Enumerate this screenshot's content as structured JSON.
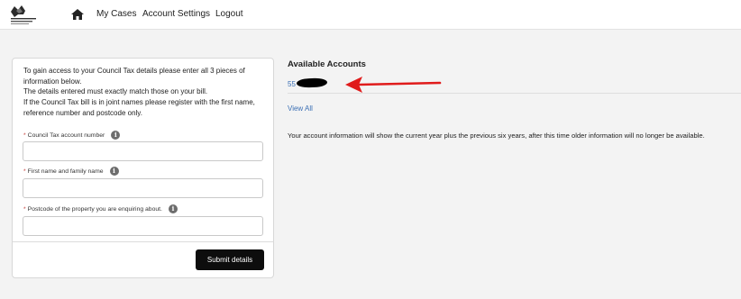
{
  "header": {
    "nav": {
      "home_icon": "home-icon",
      "my_cases": "My Cases",
      "account_settings": "Account Settings",
      "logout": "Logout"
    }
  },
  "form": {
    "intro_lines": [
      "To gain access to your Council Tax details please enter all 3 pieces of information below.",
      "The details entered must exactly match those on your bill.",
      "If the Council Tax bill is in joint names please register with the first name, reference number and postcode only."
    ],
    "required_marker": "*",
    "fields": [
      {
        "label": "Council Tax account number",
        "value": "",
        "info_icon": "info-icon"
      },
      {
        "label": "First name and family name",
        "value": "",
        "info_icon": "info-icon"
      },
      {
        "label": "Postcode of the property you are enquiring about.",
        "value": "",
        "info_icon": "info-icon"
      }
    ],
    "submit_label": "Submit details"
  },
  "accounts": {
    "title": "Available Accounts",
    "account_prefix": "55",
    "view_all": "View All",
    "info": "Your account information will show the current year plus the previous six years, after this time older information will no longer be available."
  },
  "colors": {
    "link": "#3b6fb4",
    "required": "#c23934",
    "button": "#0d0d0d",
    "arrow": "#e01b1b"
  }
}
